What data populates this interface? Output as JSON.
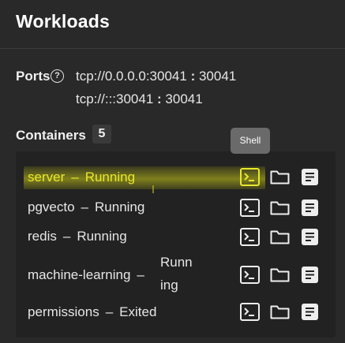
{
  "title": "Workloads",
  "ports": {
    "label": "Ports",
    "help_icon": "?",
    "entries": [
      {
        "address": "tcp://0.0.0.0:30041",
        "sep": " : ",
        "target": "30041"
      },
      {
        "address": "tcp://:::30041",
        "sep": " : ",
        "target": "30041"
      }
    ]
  },
  "containers": {
    "label": "Containers",
    "count": "5",
    "tooltip": "Shell",
    "separator": "–",
    "items": [
      {
        "name": "server",
        "status": "Running"
      },
      {
        "name": "pgvecto",
        "status": "Running"
      },
      {
        "name": "redis",
        "status": "Running"
      },
      {
        "name": "machine-learning",
        "status_part1": "Runn",
        "status_part2": "ing"
      },
      {
        "name": "permissions",
        "status": "Exited"
      }
    ]
  },
  "icons": {
    "shell": "terminal-icon",
    "folder": "folder-icon",
    "logs": "logs-icon"
  },
  "colors": {
    "highlight": "#e8e82a",
    "background": "#292929",
    "list_background": "#222222"
  }
}
